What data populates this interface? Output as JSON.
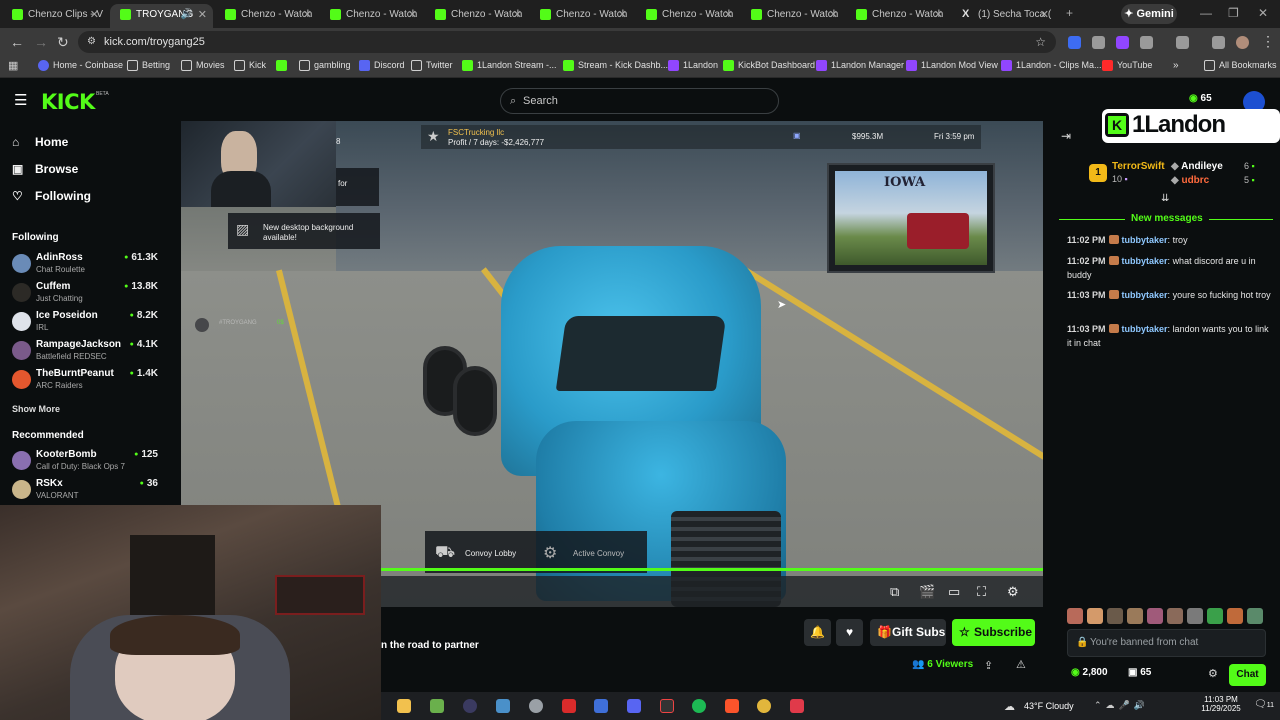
{
  "browser": {
    "tabs": [
      {
        "label": "Chenzo Clips - V",
        "active": false
      },
      {
        "label": "TROYGANG",
        "active": true
      },
      {
        "label": "Chenzo - Watch",
        "active": false
      },
      {
        "label": "Chenzo - Watch",
        "active": false
      },
      {
        "label": "Chenzo - Watch",
        "active": false
      },
      {
        "label": "Chenzo - Watch",
        "active": false
      },
      {
        "label": "Chenzo - Watch",
        "active": false
      },
      {
        "label": "Chenzo - Watch",
        "active": false
      },
      {
        "label": "Chenzo - Watch",
        "active": false
      },
      {
        "label": "(1) Secha Toca (",
        "active": false
      }
    ],
    "gemini_label": "Gemini",
    "url": "kick.com/troygang25",
    "bookmarks": [
      {
        "label": "Home - Coinbase",
        "icon": "coinbase"
      },
      {
        "label": "Betting",
        "icon": "folder"
      },
      {
        "label": "Movies",
        "icon": "folder"
      },
      {
        "label": "Kick",
        "icon": "folder"
      },
      {
        "label": "gambling",
        "icon": "folder"
      },
      {
        "label": "Discord",
        "icon": "discord"
      },
      {
        "label": "Twitter",
        "icon": "folder"
      },
      {
        "label": "1Landon Stream -...",
        "icon": "kick"
      },
      {
        "label": "Stream - Kick Dashb...",
        "icon": "kick"
      },
      {
        "label": "1Landon",
        "icon": "purple"
      },
      {
        "label": "KickBot Dashboard",
        "icon": "kick"
      },
      {
        "label": "1Landon Manager",
        "icon": "purple"
      },
      {
        "label": "1Landon Mod View",
        "icon": "purple"
      },
      {
        "label": "1Landon - Clips Ma...",
        "icon": "purple"
      },
      {
        "label": "YouTube",
        "icon": "youtube"
      }
    ],
    "all_bookmarks": "All Bookmarks"
  },
  "kick": {
    "logo": "KICK",
    "beta": "BETA",
    "search_placeholder": "Search",
    "nav": [
      {
        "label": "Home",
        "icon": "home-icon"
      },
      {
        "label": "Browse",
        "icon": "browse-icon"
      },
      {
        "label": "Following",
        "icon": "heart-icon"
      }
    ],
    "following_title": "Following",
    "following": [
      {
        "name": "AdinRoss",
        "category": "Chat Roulette",
        "viewers": "61.3K"
      },
      {
        "name": "Cuffem",
        "category": "Just Chatting",
        "viewers": "13.8K"
      },
      {
        "name": "Ice Poseidon",
        "category": "IRL",
        "viewers": "8.2K"
      },
      {
        "name": "RampageJackson",
        "category": "Battlefield REDSEC",
        "viewers": "4.1K"
      },
      {
        "name": "TheBurntPeanut",
        "category": "ARC Raiders",
        "viewers": "1.4K"
      }
    ],
    "show_more": "Show More",
    "recommended_title": "Recommended",
    "recommended": [
      {
        "name": "KooterBomb",
        "category": "Call of Duty: Black Ops 7",
        "viewers": "125"
      },
      {
        "name": "RSKx",
        "category": "VALORANT",
        "viewers": "36"
      }
    ]
  },
  "video": {
    "company": "FSCTrucking llc",
    "profit": "Profit / 7 days: -$2,426,777",
    "money": "$995.3M",
    "time": "Fri 3:59 pm",
    "notif": "New desktop background available!",
    "partial_top": "for",
    "partial_num": "8",
    "postcard": "IOWA",
    "convoy_lobby": "Convoy Lobby",
    "active_convoy": "Active Convoy",
    "chat_overlay": "#TROYGANG",
    "chat_overlay_count": "0$",
    "progress_pct": 100,
    "stream_title": "n the road to partner",
    "viewers": "6 Viewers",
    "gift_subs": "Gift Subs",
    "subscribe": "Subscribe"
  },
  "chat": {
    "brand": "1Landon",
    "count_top": "65",
    "leaders": [
      {
        "rank": "1",
        "name": "TerrorSwift",
        "value": "10"
      },
      {
        "name": "Andileye",
        "value": "6"
      },
      {
        "name": "udbrc",
        "value": "5"
      }
    ],
    "new_messages": "New messages",
    "messages": [
      {
        "time": "11:02 PM",
        "user": "tubbytaker",
        "text": "troy"
      },
      {
        "time": "11:02 PM",
        "user": "tubbytaker",
        "text": "what discord are u in buddy"
      },
      {
        "time": "11:03 PM",
        "user": "tubbytaker",
        "text": "youre so fucking hot troy"
      },
      {
        "time": "11:03 PM",
        "user": "tubbytaker",
        "text": "landon wants you to link it in chat"
      }
    ],
    "banned_placeholder": "You're banned from chat",
    "points": "2,800",
    "gifts": "65",
    "chat_button": "Chat"
  },
  "taskbar": {
    "temp": "43°F",
    "weather": "Cloudy",
    "time": "11:03 PM",
    "date": "11/29/2025",
    "notif_count": "11"
  },
  "colors": {
    "kick_green": "#53fc18",
    "bg": "#0b0e0f"
  }
}
